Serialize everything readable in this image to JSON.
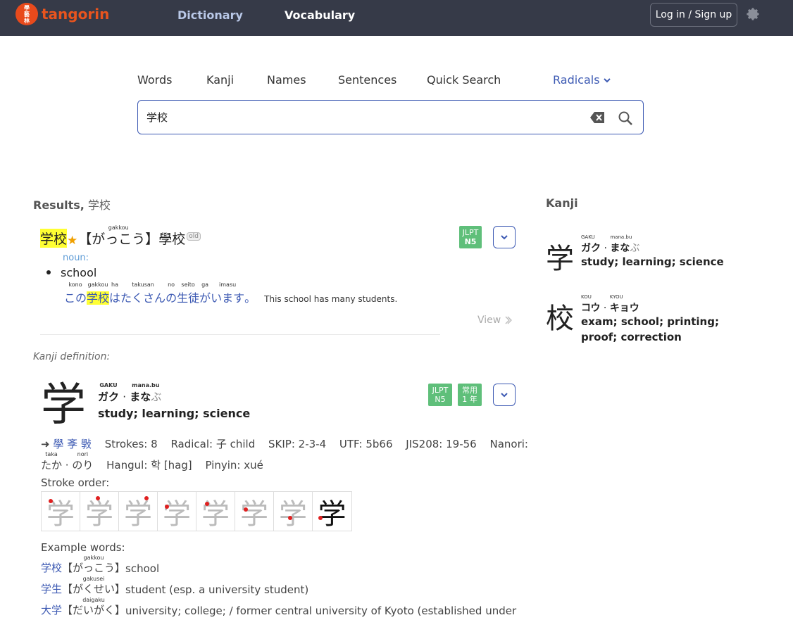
{
  "app": {
    "logo_seal": "學藝林",
    "logo_text": "tangorin"
  },
  "nav": {
    "dictionary": "Dictionary",
    "vocabulary": "Vocabulary",
    "login": "Log in / Sign up"
  },
  "tabs": {
    "words": "Words",
    "kanji": "Kanji",
    "names": "Names",
    "sentences": "Sentences",
    "quick_search": "Quick Search",
    "radicals": "Radicals"
  },
  "search": {
    "value": "学校"
  },
  "results": {
    "label": "Results,",
    "query": "学校"
  },
  "kanji_panel_title": "Kanji",
  "entry": {
    "word": "学校",
    "reading_furi": "gakkou",
    "reading": "【がっこう】",
    "old_form": "學校",
    "old_badge": "old",
    "pos": "noun:",
    "gloss": "school",
    "jlpt_top": "JLPT",
    "jlpt_level": "N5",
    "sentence": {
      "parts": [
        {
          "text": "この",
          "furi": "kono",
          "hl": false
        },
        {
          "text": "学校",
          "furi": "gakkou",
          "hl": true
        },
        {
          "text": "は",
          "furi": "ha",
          "hl": false
        },
        {
          "text": "たくさん",
          "furi": "takusan",
          "hl": false
        },
        {
          "text": "の",
          "furi": "no",
          "hl": false
        },
        {
          "text": "生徒",
          "furi": "seito",
          "hl": false
        },
        {
          "text": "が",
          "furi": "ga",
          "hl": false
        },
        {
          "text": "います",
          "furi": "imasu",
          "hl": false
        },
        {
          "text": "。",
          "furi": "",
          "hl": false
        }
      ],
      "english": "This school has many students."
    },
    "view": "View"
  },
  "kanji_def_label": "Kanji definition:",
  "kanji_def": {
    "char": "学",
    "on_furi": "GAKU",
    "kun_furi": "mana.bu",
    "on": "ガク",
    "sep": "·",
    "kun": "まな",
    "kun_okurigana": "ぶ",
    "meaning": "study; learning; science",
    "jlpt_top": "JLPT",
    "jlpt_level": "N5",
    "joyo_top": "常用",
    "joyo_grade": "1 年",
    "variants_arrow": "➜",
    "variants": "學 斈 斅",
    "strokes": "Strokes: 8",
    "radical": "Radical: 子 child",
    "skip": "SKIP: 2-3-4",
    "utf": "UTF: 5b66",
    "jis": "JIS208: 19-56",
    "nanori_label": "Nanori:",
    "nanori_1": "たか",
    "nanori_1_furi": "taka",
    "nanori_sep": "·",
    "nanori_2": "のり",
    "nanori_2_furi": "nori",
    "hangul": "Hangul: 학 [hag]",
    "pinyin": "Pinyin: xué",
    "stroke_order_label": "Stroke order:",
    "stroke_frames": [
      "学",
      "学",
      "学",
      "学",
      "学",
      "学",
      "学",
      "学"
    ],
    "examples_label": "Example words:",
    "examples": [
      {
        "word": "学校",
        "furi": "gakkou",
        "reading": "がっこう",
        "meaning": "school"
      },
      {
        "word": "学生",
        "furi": "gakusei",
        "reading": "がくせい",
        "meaning": "student (esp. a university student)"
      },
      {
        "word": "大学",
        "furi": "daigaku",
        "reading": "だいがく",
        "meaning": "university; college; / former central university of Kyoto (established under"
      }
    ]
  },
  "right_kanji": [
    {
      "char": "学",
      "on_furi": "GAKU",
      "kun_furi": "mana.bu",
      "on": "ガク",
      "sep": "·",
      "kun": "まな",
      "kun_okurigana": "ぶ",
      "meaning": "study; learning; science"
    },
    {
      "char": "校",
      "on_furi": "KOU",
      "kun_furi": "KYOU",
      "on": "コウ",
      "sep": "·",
      "kun": "キョウ",
      "kun_okurigana": "",
      "meaning": "exam; school; printing; proof; correction"
    }
  ],
  "colors": {
    "topbar": "#363a48",
    "accent": "#3d5ab3",
    "highlight": "#ffff33",
    "jlpt": "#5fbf7a",
    "logo": "#e8541e"
  }
}
